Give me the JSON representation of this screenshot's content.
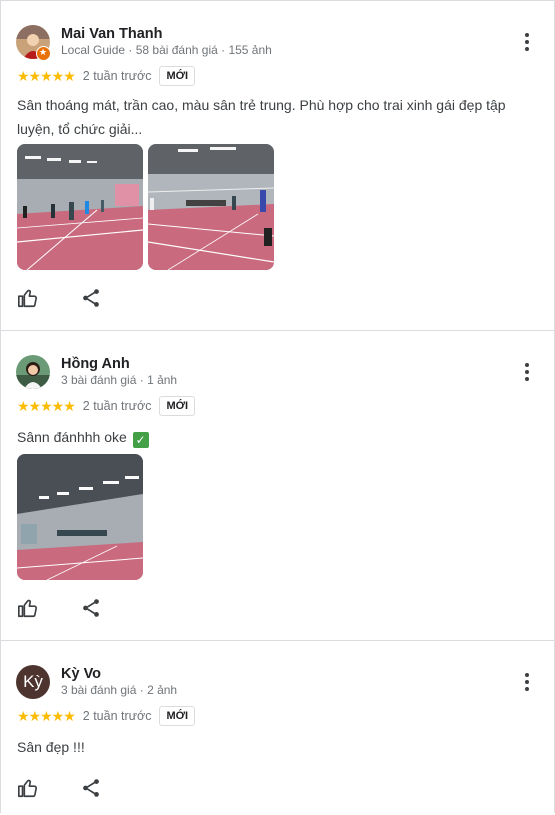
{
  "reviews": [
    {
      "author": "Mai Van Thanh",
      "meta": "Local Guide · 58 bài đánh giá · 155 ảnh",
      "stars": "★★★★★",
      "time": "2 tuần trước",
      "badge": "MỚI",
      "text": "Sân thoáng mát, trần cao, màu sân trẻ trung. Phù hợp cho trai xinh gái đẹp tập luyện, tổ chức giải..."
    },
    {
      "author": "Hồng Anh",
      "meta": "3 bài đánh giá · 1 ảnh",
      "stars": "★★★★★",
      "time": "2 tuần trước",
      "badge": "MỚI",
      "text": "Sânn đánhhh oke"
    },
    {
      "author": "Kỳ Vo",
      "avatar_letter": "Kỳ",
      "meta": "3 bài đánh giá · 2 ảnh",
      "stars": "★★★★★",
      "time": "2 tuần trước",
      "badge": "MỚI",
      "text": "Sân đẹp !!!"
    }
  ],
  "icons": {
    "like": "thumb-up-icon",
    "share": "share-icon",
    "more": "more-vertical-icon",
    "check": "check-mark-emoji"
  },
  "colors": {
    "star": "#fbbc04",
    "court_floor": "#c96a7e",
    "guide_badge": "#e8710a"
  }
}
